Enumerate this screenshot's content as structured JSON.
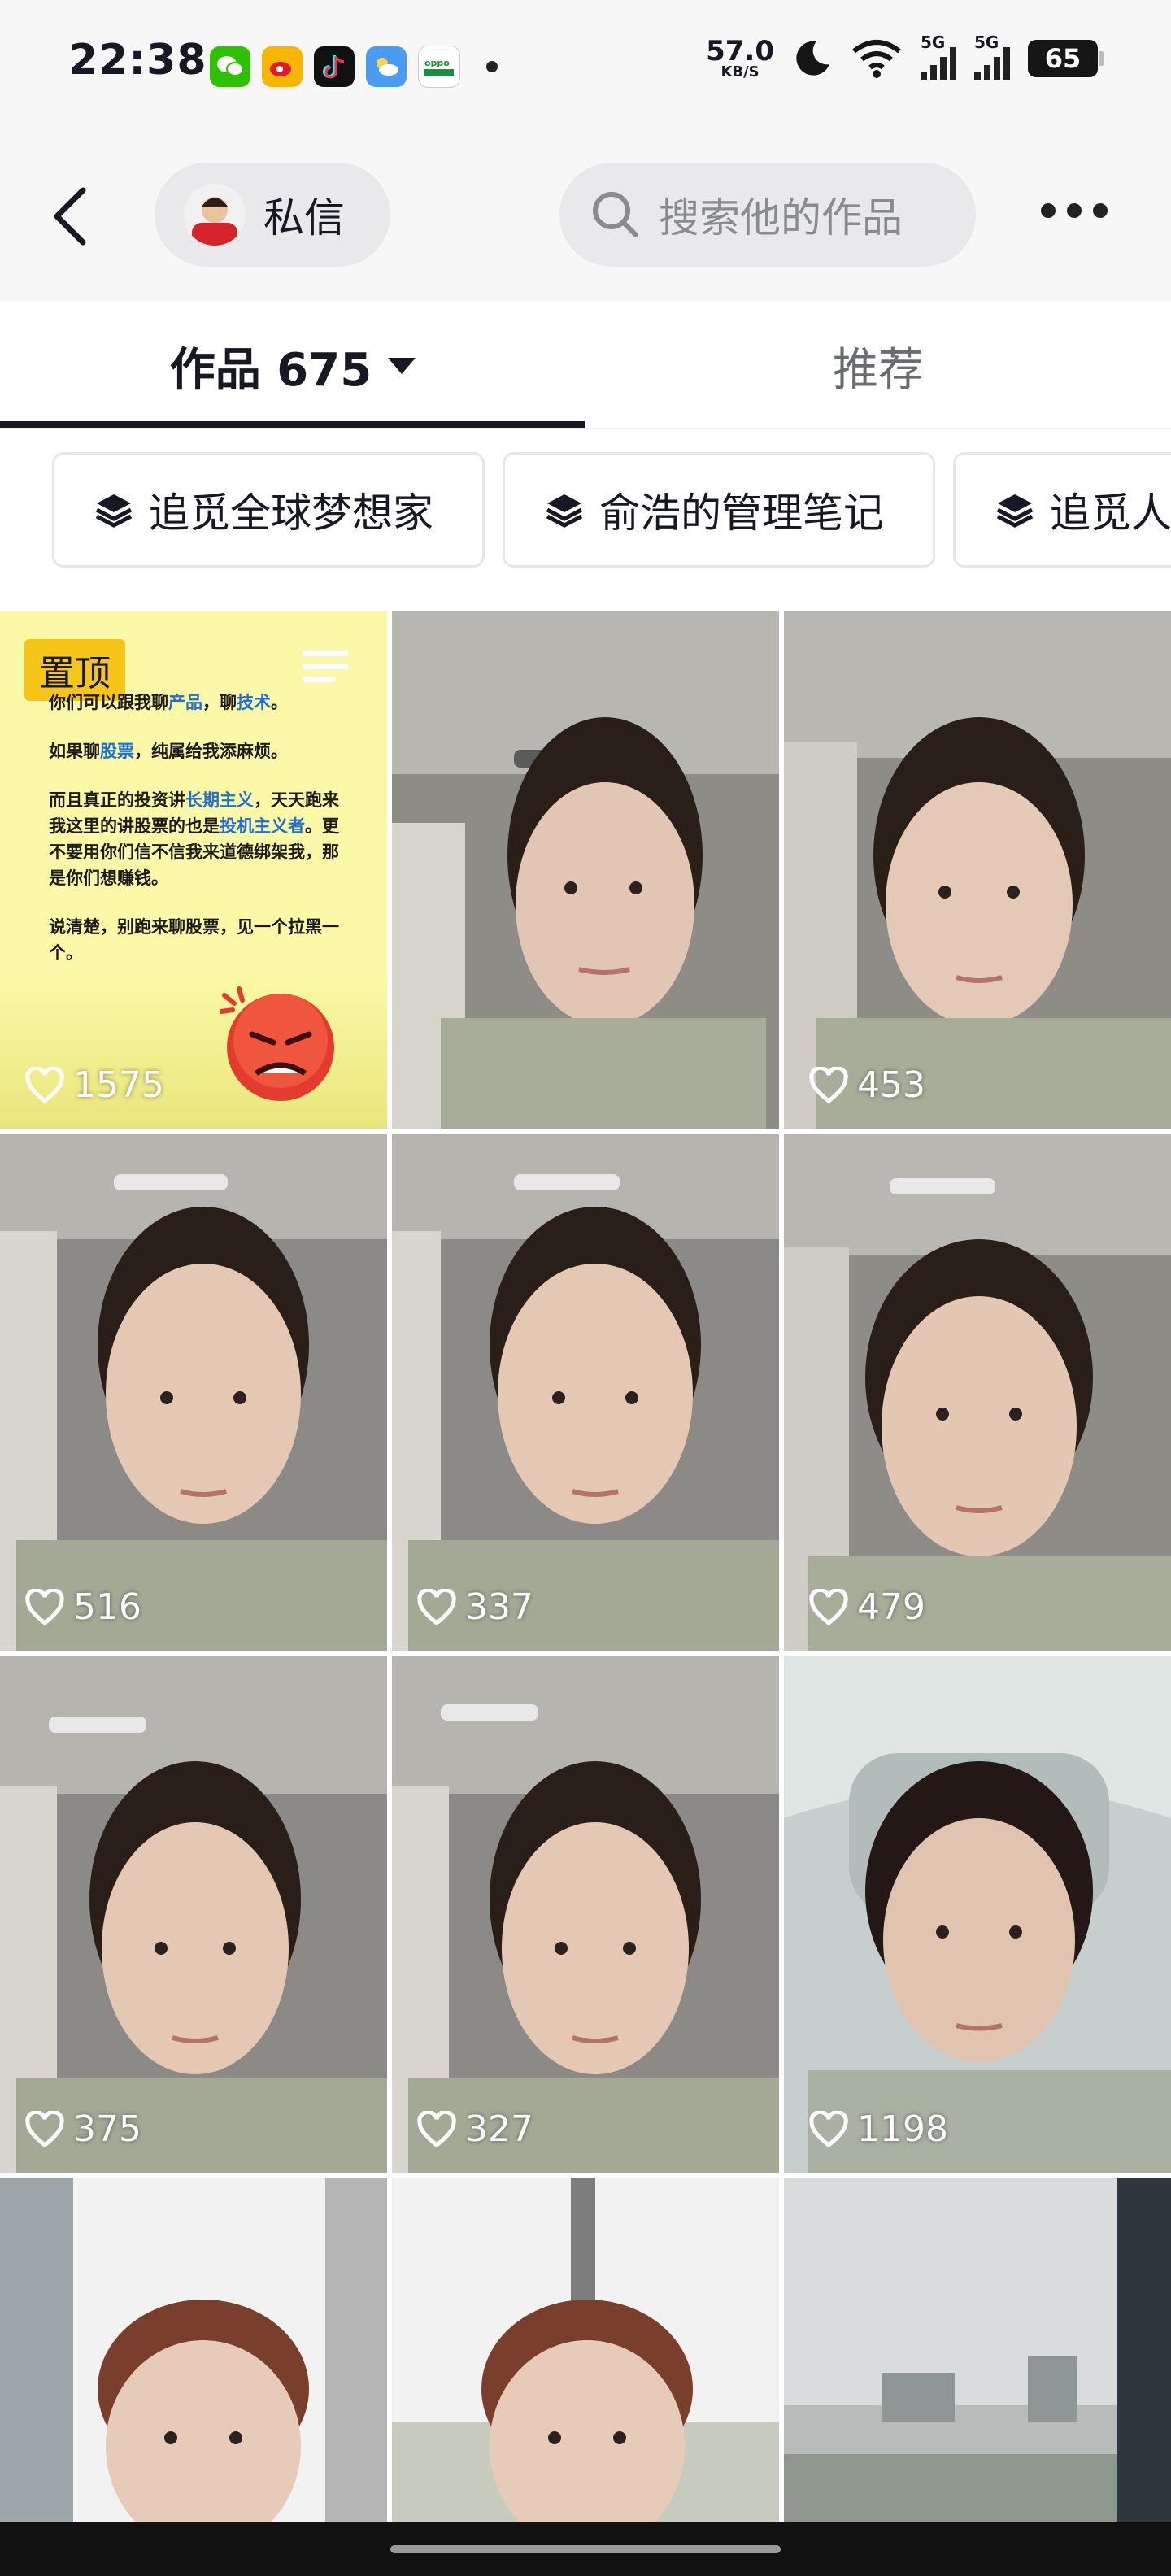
{
  "status_bar": {
    "time": "22:38",
    "app_icons": [
      "wechat-icon",
      "weibo-icon",
      "tiktok-icon",
      "weather-icon",
      "oppo-store-icon"
    ],
    "net_speed_value": "57.0",
    "net_speed_unit": "KB/S",
    "sim1_label": "5G",
    "sim2_label": "5G",
    "battery": "65"
  },
  "header": {
    "dm_label": "私信",
    "search_placeholder": "搜索他的作品"
  },
  "tabs": [
    {
      "label": "作品 675",
      "active": true
    },
    {
      "label": "推荐",
      "active": false
    }
  ],
  "collections": [
    {
      "label": "追觅全球梦想家"
    },
    {
      "label": "俞浩的管理笔记"
    },
    {
      "label": "追觅人"
    }
  ],
  "videos": [
    {
      "likes": "1575",
      "pinned": true,
      "pin_label": "置顶"
    },
    {
      "likes": ""
    },
    {
      "likes": "453"
    },
    {
      "likes": "516"
    },
    {
      "likes": "337"
    },
    {
      "likes": "479"
    },
    {
      "likes": "375"
    },
    {
      "likes": "327"
    },
    {
      "likes": "1198"
    },
    {
      "likes": ""
    },
    {
      "likes": ""
    },
    {
      "likes": ""
    }
  ],
  "pinned_post": {
    "line1_a": "你们可以跟我聊",
    "line1_b": "产品",
    "line1_c": "，聊",
    "line1_d": "技术",
    "line1_e": "。",
    "line2_a": "如果聊",
    "line2_b": "股票",
    "line2_c": "，纯属给我添麻烦。",
    "line3_a": "而且真正的投资讲",
    "line3_b": "长期主义",
    "line3_c": "，天天跑来我这里的讲股票的也是",
    "line3_d": "投机主义者",
    "line3_e": "。更不要用你们信不信我来道德绑架我，那是你们想赚钱。",
    "line4": "说清楚，别跑来聊股票，见一个拉黑一个。"
  },
  "colors": {
    "accent_dark": "#161823",
    "pin_yellow": "#f5c518",
    "highlight_blue": "#1f6fd6"
  }
}
